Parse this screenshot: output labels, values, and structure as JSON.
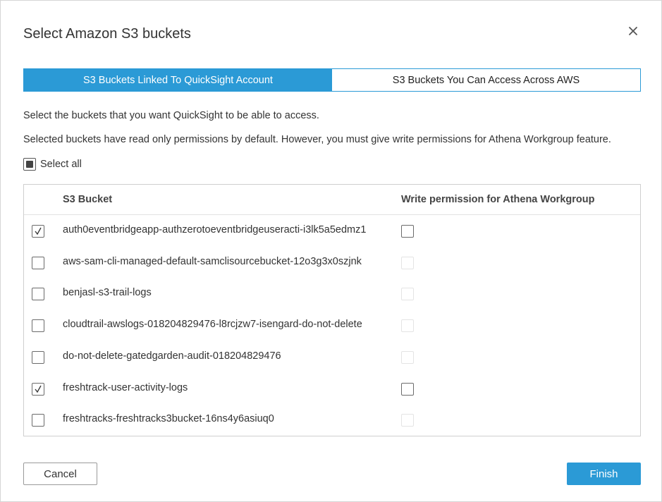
{
  "dialog": {
    "title": "Select Amazon S3 buckets",
    "close_icon": "close-icon"
  },
  "tabs": [
    {
      "label": "S3 Buckets Linked To QuickSight Account",
      "active": true
    },
    {
      "label": "S3 Buckets You Can Access Across AWS",
      "active": false
    }
  ],
  "description": {
    "line1": "Select the buckets that you want QuickSight to be able to access.",
    "line2": "Selected buckets have read only permissions by default. However, you must give write permissions for Athena Workgroup feature."
  },
  "select_all": {
    "label": "Select all",
    "state": "indeterminate"
  },
  "table": {
    "columns": [
      "S3 Bucket",
      "Write permission for Athena Workgroup"
    ],
    "rows": [
      {
        "name": "auth0eventbridgeapp-authzerotoeventbridgeuseracti-i3lk5a5edmz1",
        "selected": true,
        "write_enabled": true,
        "write_checked": false
      },
      {
        "name": "aws-sam-cli-managed-default-samclisourcebucket-12o3g3x0szjnk",
        "selected": false,
        "write_enabled": false,
        "write_checked": false
      },
      {
        "name": "benjasl-s3-trail-logs",
        "selected": false,
        "write_enabled": false,
        "write_checked": false
      },
      {
        "name": "cloudtrail-awslogs-018204829476-l8rcjzw7-isengard-do-not-delete",
        "selected": false,
        "write_enabled": false,
        "write_checked": false
      },
      {
        "name": "do-not-delete-gatedgarden-audit-018204829476",
        "selected": false,
        "write_enabled": false,
        "write_checked": false
      },
      {
        "name": "freshtrack-user-activity-logs",
        "selected": true,
        "write_enabled": true,
        "write_checked": false
      },
      {
        "name": "freshtracks-freshtracks3bucket-16ns4y6asiuq0",
        "selected": false,
        "write_enabled": false,
        "write_checked": false
      }
    ]
  },
  "footer": {
    "cancel_label": "Cancel",
    "finish_label": "Finish"
  },
  "colors": {
    "accent": "#2b9ad6"
  }
}
